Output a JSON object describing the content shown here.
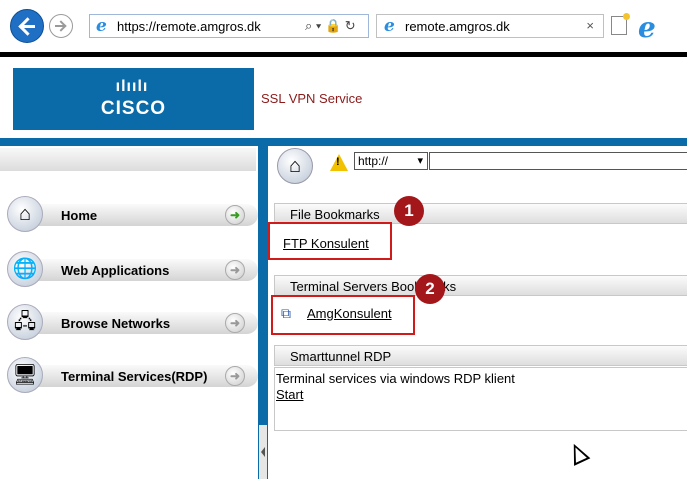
{
  "browser": {
    "address_url": "https://remote.amgros.dk",
    "address_icons": "⌕ ▾ 🔒 ↻",
    "tab_title": "remote.amgros.dk",
    "tab_close": "×",
    "ie_glyph": "e"
  },
  "header": {
    "logo_bars": "ılıılı",
    "logo_text": "CISCO",
    "service_title": "SSL VPN Service",
    "colors": {
      "brand": "#0b6ba8",
      "service_title": "#8b1a1a"
    }
  },
  "sidebar": {
    "items": [
      {
        "label": "Home",
        "icon": "home-icon",
        "glyph": "⌂",
        "arrow": "➜",
        "active": true
      },
      {
        "label": "Web Applications",
        "icon": "globe-icon",
        "glyph": "🌐",
        "arrow": "➜",
        "active": false
      },
      {
        "label": "Browse Networks",
        "icon": "network-icon",
        "glyph": "🖧",
        "arrow": "➜",
        "active": false
      },
      {
        "label": "Terminal Services(RDP)",
        "icon": "monitor-icon",
        "glyph": "🖥",
        "arrow": "➜",
        "active": false
      }
    ]
  },
  "toolbar": {
    "home_glyph": "⌂",
    "warning_glyph": "!",
    "protocol_value": "http://",
    "protocol_caret": "▾",
    "url_value": ""
  },
  "sections": {
    "file_bookmarks": {
      "title": "File Bookmarks",
      "link": "FTP Konsulent",
      "badge": "1"
    },
    "terminal_bookmarks": {
      "title": "Terminal Servers Bookmarks",
      "link": "AmgKonsulent",
      "link_icon": "⧉",
      "badge": "2"
    },
    "smarttunnel": {
      "title": "Smarttunnel RDP",
      "description": "Terminal services via windows RDP klient",
      "start_link": "Start"
    }
  },
  "annotation_color": "#d11a1a"
}
